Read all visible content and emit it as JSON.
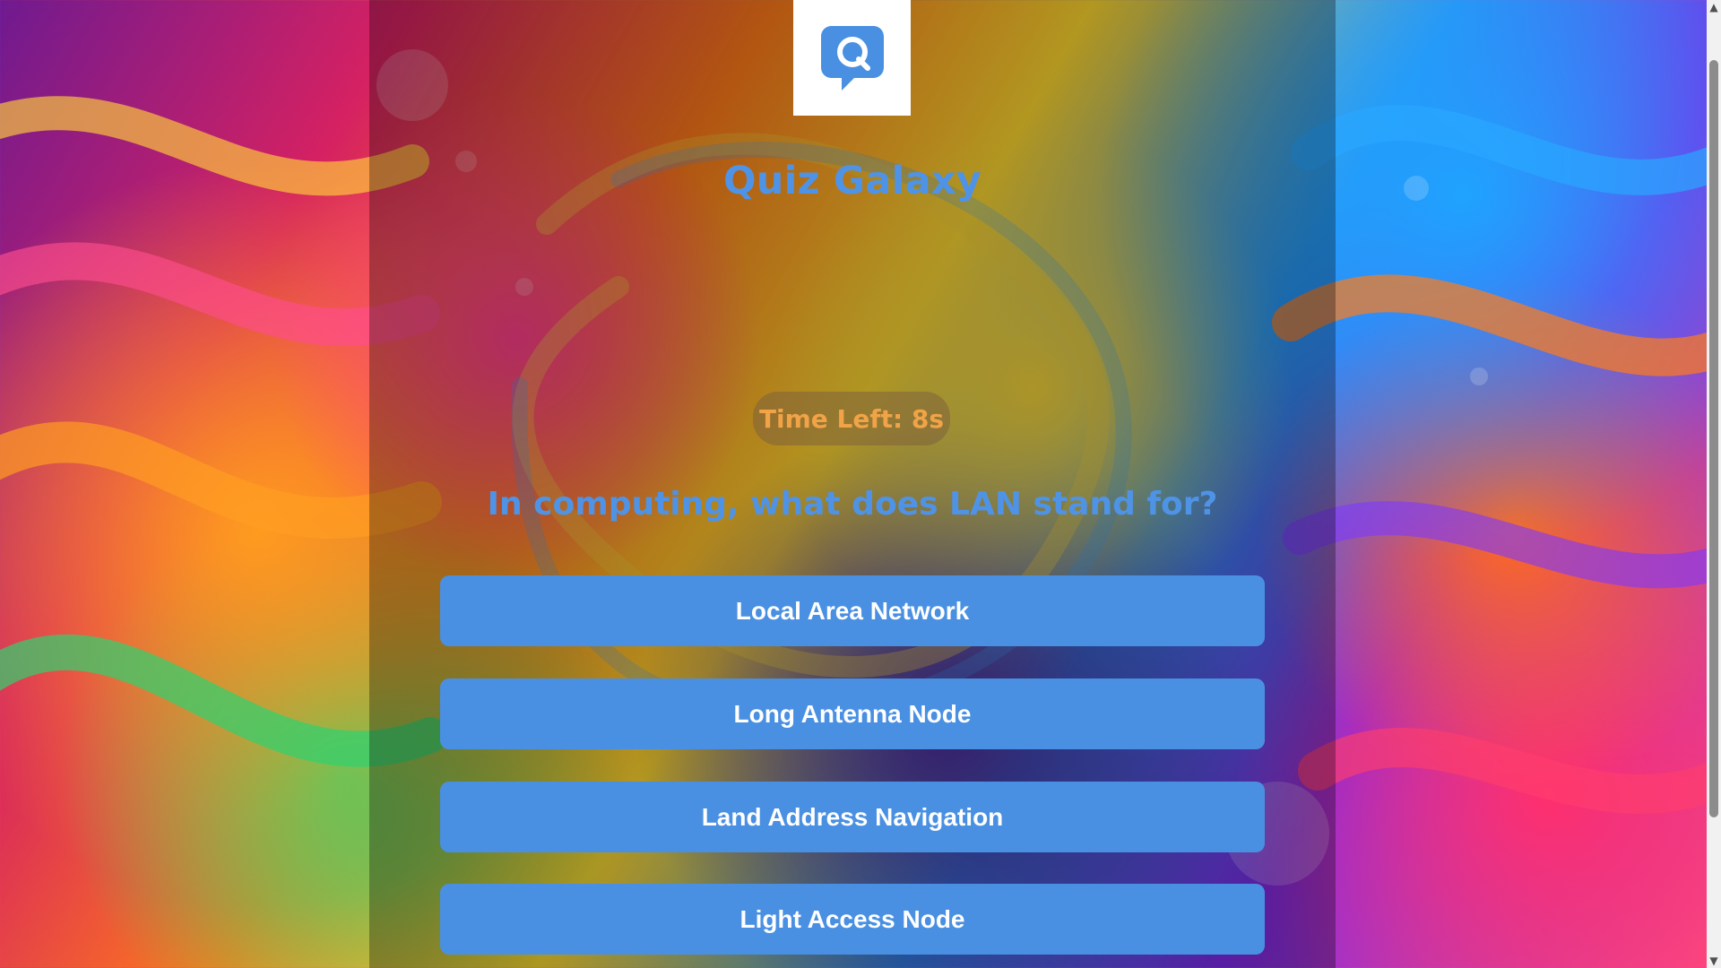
{
  "app": {
    "title": "Quiz Galaxy",
    "logo_icon": "chat-bubble-q-icon"
  },
  "quiz": {
    "timer_text": "Time Left: 8s",
    "question": "In computing, what does LAN stand for?",
    "options": [
      {
        "label": "Local Area Network"
      },
      {
        "label": "Long Antenna Node"
      },
      {
        "label": "Land Address Navigation"
      },
      {
        "label": "Light Access Node"
      }
    ]
  },
  "theme": {
    "accent": "#4A90E2",
    "title_color": "#4F93E6",
    "timer_text_color": "#F0A347",
    "panel_overlay": "rgba(0,0,0,0.30)"
  }
}
